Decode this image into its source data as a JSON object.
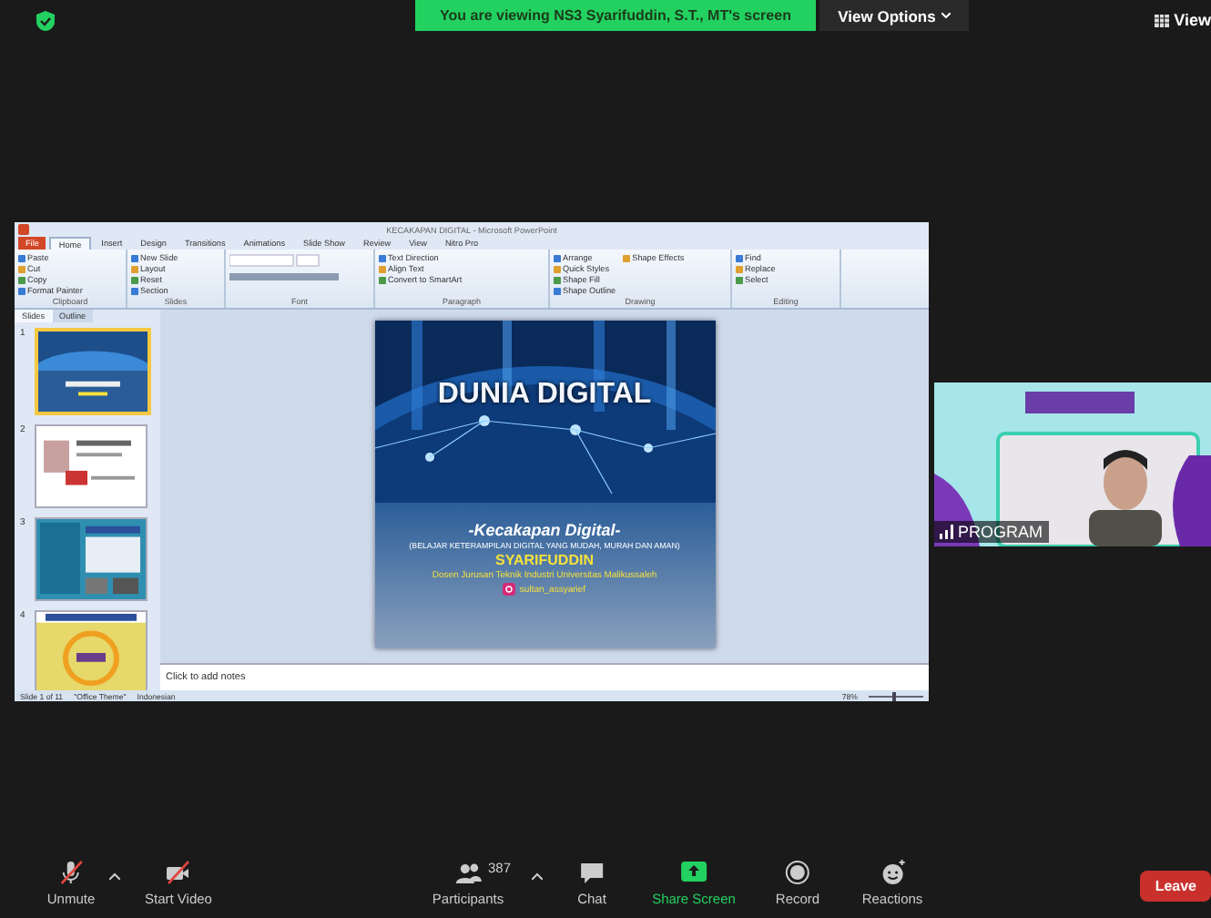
{
  "top_bar": {
    "banner": "You are viewing NS3 Syarifuddin, S.T., MT's screen",
    "view_options": "View Options",
    "view": "View"
  },
  "powerpoint": {
    "title": "KECAKAPAN DIGITAL - Microsoft PowerPoint",
    "tabs": [
      {
        "label": "File",
        "selected": false,
        "kind": "file"
      },
      {
        "label": "Home",
        "selected": true,
        "kind": "tab"
      },
      {
        "label": "Insert",
        "selected": false,
        "kind": "tab"
      },
      {
        "label": "Design",
        "selected": false,
        "kind": "tab"
      },
      {
        "label": "Transitions",
        "selected": false,
        "kind": "tab"
      },
      {
        "label": "Animations",
        "selected": false,
        "kind": "tab"
      },
      {
        "label": "Slide Show",
        "selected": false,
        "kind": "tab"
      },
      {
        "label": "Review",
        "selected": false,
        "kind": "tab"
      },
      {
        "label": "View",
        "selected": false,
        "kind": "tab"
      },
      {
        "label": "Nitro Pro",
        "selected": false,
        "kind": "tab"
      }
    ],
    "ribbon_groups": [
      {
        "label": "Clipboard",
        "items": [
          "Paste",
          "Cut",
          "Copy",
          "Format Painter"
        ]
      },
      {
        "label": "Slides",
        "items": [
          "New Slide",
          "Layout",
          "Reset",
          "Section"
        ]
      },
      {
        "label": "Font"
      },
      {
        "label": "Paragraph",
        "items": [
          "Text Direction",
          "Align Text",
          "Convert to SmartArt"
        ]
      },
      {
        "label": "Drawing",
        "items": [
          "Arrange",
          "Quick Styles",
          "Shape Fill",
          "Shape Outline",
          "Shape Effects"
        ]
      },
      {
        "label": "Editing",
        "items": [
          "Find",
          "Replace",
          "Select"
        ]
      }
    ],
    "panel_tabs": [
      {
        "label": "Slides",
        "selected": true
      },
      {
        "label": "Outline",
        "selected": false
      }
    ],
    "thumbnails": [
      {
        "number": "1",
        "selected": true
      },
      {
        "number": "2",
        "selected": false
      },
      {
        "number": "3",
        "selected": false
      },
      {
        "number": "4",
        "selected": false
      }
    ],
    "slide": {
      "heading": "DUNIA DIGITAL",
      "subtitle": "-Kecakapan Digital-",
      "tagline": "(BELAJAR KETERAMPILAN DIGITAL YANG MUDAH, MURAH DAN AMAN)",
      "presenter": "SYARIFUDDIN",
      "affiliation": "Dosen Jurusan Teknik Industri Universitas Malikussaleh",
      "instagram": "sultan_assyarief"
    },
    "notes_placeholder": "Click to add notes",
    "status": {
      "slide_count": "Slide 1 of 11",
      "theme": "\"Office Theme\"",
      "language": "Indonesian",
      "zoom": "78%",
      "level": 0.45
    }
  },
  "video": {
    "name": "PROGRAM"
  },
  "toolbar": [
    {
      "kind": "mic",
      "label": "Unmute",
      "off": true
    },
    {
      "kind": "camera",
      "label": "Start Video",
      "off": true
    },
    {
      "kind": "participants",
      "label": "Participants",
      "count": "387"
    },
    {
      "kind": "chat",
      "label": "Chat"
    },
    {
      "kind": "share",
      "label": "Share Screen"
    },
    {
      "kind": "record",
      "label": "Record"
    },
    {
      "kind": "reactions",
      "label": "Reactions"
    }
  ],
  "leave": "Leave"
}
